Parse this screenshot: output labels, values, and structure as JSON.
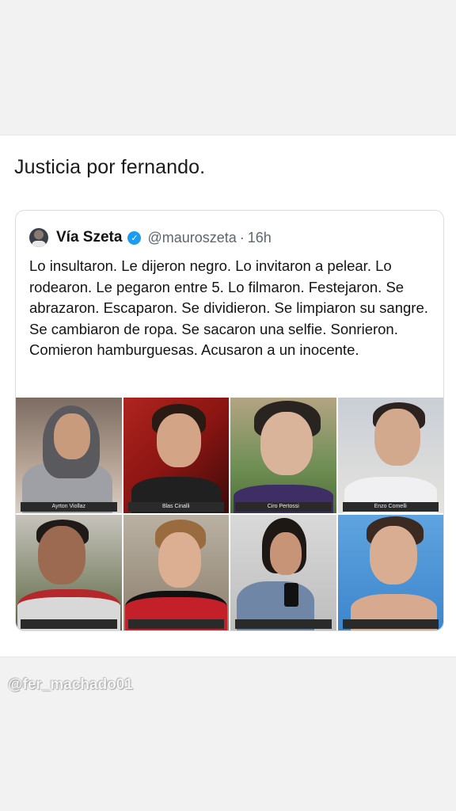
{
  "post": {
    "text": "Justicia por fernando."
  },
  "quoted_tweet": {
    "author_name": "Vía Szeta",
    "handle": "@mauroszeta",
    "separator": "·",
    "time": "16h",
    "verified_icon": "verified-badge-icon",
    "body": "Lo insultaron. Le dijeron negro. Lo invitaron a pelear. Lo rodearon. Le pegaron entre 5. Lo filmaron. Festejaron. Se abrazaron. Escaparon. Se dividieron. Se limpiaron su sangre. Se cambiaron de ropa. Se sacaron una selfie. Sonrieron. Comieron hamburguesas. Acusaron a un inocente.",
    "photos": [
      {
        "caption": "Ayrton Viollaz"
      },
      {
        "caption": "Blas Cinalli"
      },
      {
        "caption": "Ciro Pertossi"
      },
      {
        "caption": "Enzo Comelli"
      },
      {
        "caption": ""
      },
      {
        "caption": ""
      },
      {
        "caption": ""
      },
      {
        "caption": ""
      }
    ]
  },
  "watermark": "@fer_machado01",
  "colors": {
    "background": "#f2f2f2",
    "card": "#ffffff",
    "verified": "#1d9bf0",
    "secondary_text": "#5b6670"
  }
}
